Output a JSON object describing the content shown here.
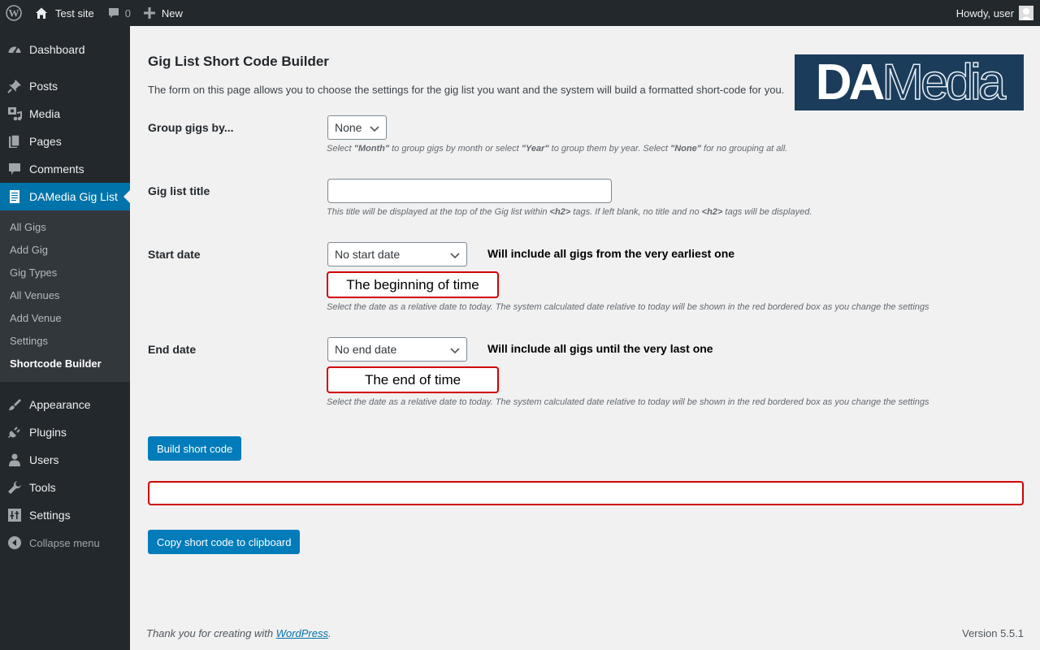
{
  "adminbar": {
    "site_name": "Test site",
    "comments_count": "0",
    "new_label": "New",
    "howdy": "Howdy, user"
  },
  "sidebar": {
    "items_top": [
      {
        "label": "Dashboard",
        "icon": "dashboard-icon"
      }
    ],
    "items_main": [
      {
        "label": "Posts",
        "icon": "pushpin-icon"
      },
      {
        "label": "Media",
        "icon": "media-icon"
      },
      {
        "label": "Pages",
        "icon": "pages-icon"
      },
      {
        "label": "Comments",
        "icon": "comment-icon"
      },
      {
        "label": "DAMedia Gig List",
        "icon": "document-icon"
      }
    ],
    "submenu": [
      "All Gigs",
      "Add Gig",
      "Gig Types",
      "All Venues",
      "Add Venue",
      "Settings",
      "Shortcode Builder"
    ],
    "items_bottom": [
      {
        "label": "Appearance",
        "icon": "paintbrush-icon"
      },
      {
        "label": "Plugins",
        "icon": "plugin-icon"
      },
      {
        "label": "Users",
        "icon": "users-icon"
      },
      {
        "label": "Tools",
        "icon": "wrench-icon"
      },
      {
        "label": "Settings",
        "icon": "settings-icon"
      }
    ],
    "collapse": "Collapse menu"
  },
  "page": {
    "title": "Gig List Short Code Builder",
    "intro": "The form on this page allows you to choose the settings for the gig list you want and the system will build a formatted short-code for you.",
    "logo_da": "DA",
    "logo_media": "Media"
  },
  "form": {
    "group": {
      "label": "Group gigs by...",
      "value": "None",
      "desc_1": "Select ",
      "desc_month": "\"Month\"",
      "desc_2": " to group gigs by month or select ",
      "desc_year": "\"Year\"",
      "desc_3": " to group them by year. Select ",
      "desc_none": "\"None\"",
      "desc_4": " for no grouping at all."
    },
    "title": {
      "label": "Gig list title",
      "value": "",
      "desc_1": "This title will be displayed at the top of the Gig list within ",
      "desc_tag1": "<h2>",
      "desc_2": " tags. If left blank, no title and no ",
      "desc_tag2": "<h2>",
      "desc_3": " tags will be displayed."
    },
    "start": {
      "label": "Start date",
      "value": "No start date",
      "note": "Will include all gigs from the very earliest one",
      "computed": "The beginning of time",
      "desc": "Select the date as a relative date to today. The system calculated date relative to today will be shown in the red bordered box as you change the settings"
    },
    "end": {
      "label": "End date",
      "value": "No end date",
      "note": "Will include all gigs until the very last one",
      "computed": "The end of time",
      "desc": "Select the date as a relative date to today. The system calculated date relative to today will be shown in the red bordered box as you change the settings"
    },
    "build_button": "Build short code",
    "output": "",
    "copy_button": "Copy short code to clipboard"
  },
  "footer": {
    "thanks_prefix": "Thank you for creating with ",
    "thanks_link": "WordPress",
    "thanks_suffix": ".",
    "version": "Version 5.5.1"
  }
}
